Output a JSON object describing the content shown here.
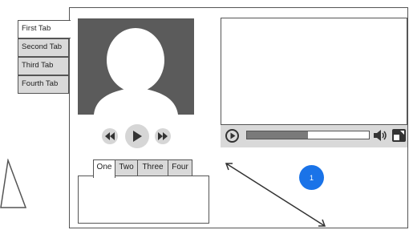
{
  "vertical_tabs": [
    {
      "label": "First Tab",
      "active": true
    },
    {
      "label": "Second Tab",
      "active": false
    },
    {
      "label": "Third Tab",
      "active": false
    },
    {
      "label": "Fourth Tab",
      "active": false
    }
  ],
  "horizontal_tabs": [
    {
      "label": "One",
      "active": true
    },
    {
      "label": "Two",
      "active": false
    },
    {
      "label": "Three",
      "active": false
    },
    {
      "label": "Four",
      "active": false
    }
  ],
  "media_controls": {
    "rewind_icon": "rewind-icon",
    "play_icon": "play-icon",
    "forward_icon": "fast-forward-icon"
  },
  "video_player": {
    "progress": 0.5,
    "play_icon": "play-icon",
    "volume_icon": "volume-icon",
    "fullscreen_icon": "fullscreen-icon"
  },
  "badge": {
    "value": "1",
    "color": "#1a73e8"
  },
  "avatar": {
    "icon": "person-silhouette-icon",
    "background": "#5b5b5b"
  }
}
